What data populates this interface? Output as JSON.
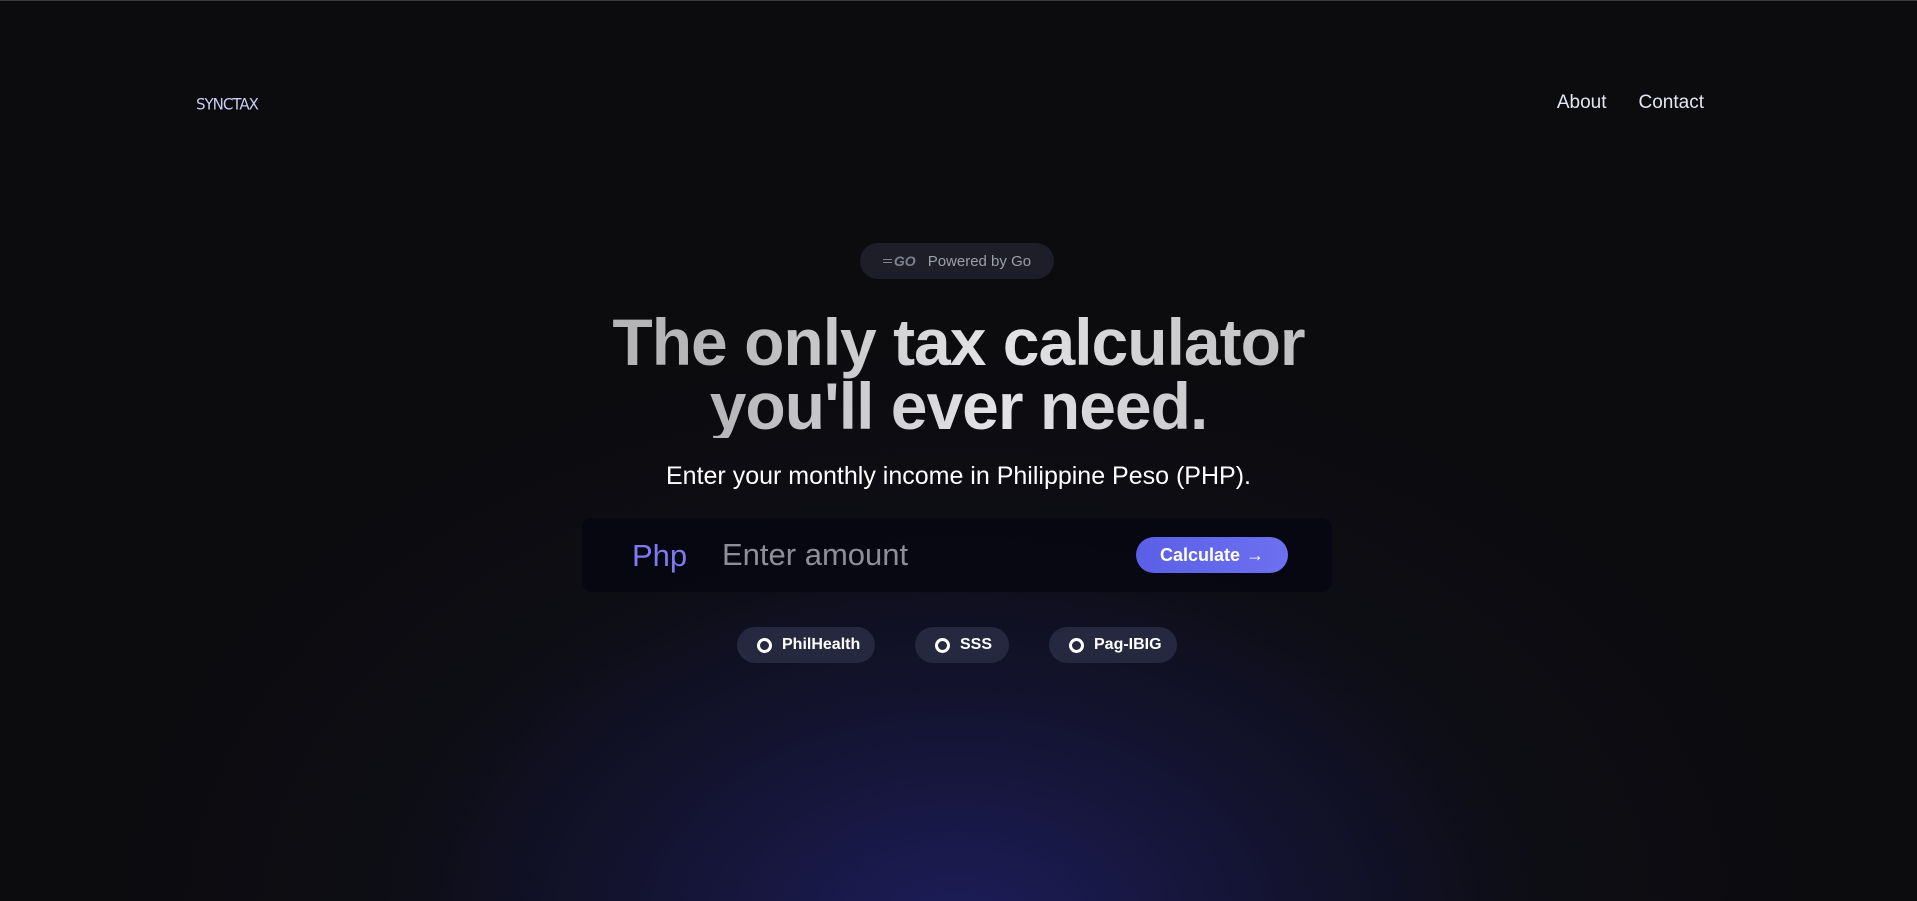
{
  "header": {
    "logo_text": "SYNCTAX",
    "nav": [
      {
        "label": "About"
      },
      {
        "label": "Contact"
      }
    ]
  },
  "badge": {
    "icon": "go-logo-icon",
    "logo_text": "GO",
    "text": "Powered by Go"
  },
  "hero": {
    "headline_line1": "The only tax calculator",
    "headline_line2": "you'll ever need.",
    "subtitle": "Enter your monthly income in Philippine Peso (PHP)."
  },
  "calculator": {
    "currency_label": "Php",
    "amount_value": "",
    "amount_placeholder": "Enter amount",
    "button_label": "Calculate",
    "button_icon": "arrow-right-icon",
    "button_arrow": "→"
  },
  "options": [
    {
      "label": "PhilHealth",
      "selected": false
    },
    {
      "label": "SSS",
      "selected": false
    },
    {
      "label": "Pag-IBIG",
      "selected": false
    }
  ],
  "colors": {
    "background": "#0c0c0e",
    "accent": "#6d70f0",
    "currency": "#7e7bf0",
    "option_bg": "#262840"
  }
}
